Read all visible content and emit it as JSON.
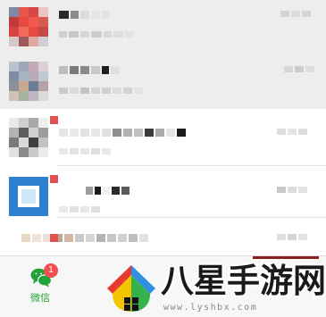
{
  "tabbar": {
    "chat_label": "微信",
    "chat_badge": "1",
    "chat_icon": "chat-bubbles-icon",
    "accent_color": "#22a33a",
    "badge_color": "#f24e4e"
  },
  "watermark": {
    "brand_text": "八星手游网",
    "url_text": "www.lyshbx.com",
    "logo": "house-logo-icon"
  }
}
